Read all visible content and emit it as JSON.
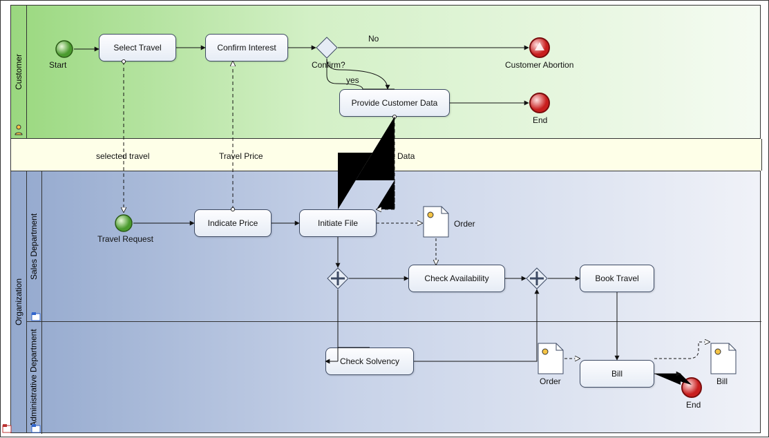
{
  "pools": {
    "customer": {
      "label": "Customer"
    },
    "organization": {
      "label": "Organization"
    }
  },
  "lanes": {
    "sales": {
      "label": "Sales Department"
    },
    "admin": {
      "label": "Administrative Department"
    }
  },
  "events": {
    "start": {
      "label": "Start"
    },
    "travel_request": {
      "label": "Travel Request"
    },
    "customer_abortion": {
      "label": "Customer Abortion"
    },
    "end_customer": {
      "label": "End"
    },
    "end_admin": {
      "label": "End"
    }
  },
  "tasks": {
    "select_travel": {
      "label": "Select Travel"
    },
    "confirm_interest": {
      "label": "Confirm Interest"
    },
    "provide_customer_data": {
      "label": "Provide Customer Data"
    },
    "indicate_price": {
      "label": "Indicate Price"
    },
    "initiate_file": {
      "label": "Initiate File"
    },
    "check_availability": {
      "label": "Check Availability"
    },
    "check_solvency": {
      "label": "Check Solvency"
    },
    "book_travel": {
      "label": "Book Travel"
    },
    "bill": {
      "label": "Bill"
    }
  },
  "gateways": {
    "confirm": {
      "label": "Confirm?",
      "yes": "yes",
      "no": "No"
    },
    "parallel_split": {},
    "parallel_join": {}
  },
  "data_objects": {
    "order_top": {
      "label": "Order"
    },
    "order_bottom": {
      "label": "Order"
    },
    "bill_doc": {
      "label": "Bill"
    }
  },
  "messages": {
    "selected_travel": "selected travel",
    "travel_price": "Travel Price",
    "client_data": "Client Data"
  },
  "chart_data": {
    "type": "bpmn",
    "pools": [
      {
        "id": "customer",
        "name": "Customer",
        "lanes": [
          "customer"
        ]
      },
      {
        "id": "organization",
        "name": "Organization",
        "lanes": [
          "sales",
          "admin"
        ]
      }
    ],
    "lanes": [
      {
        "id": "customer",
        "name": "Customer",
        "pool": "customer"
      },
      {
        "id": "sales",
        "name": "Sales Department",
        "pool": "organization"
      },
      {
        "id": "admin",
        "name": "Administrative Department",
        "pool": "organization"
      }
    ],
    "elements": [
      {
        "id": "start",
        "type": "startEvent",
        "name": "Start",
        "lane": "customer"
      },
      {
        "id": "select_travel",
        "type": "task",
        "name": "Select Travel",
        "lane": "customer"
      },
      {
        "id": "confirm_interest",
        "type": "task",
        "name": "Confirm Interest",
        "lane": "customer"
      },
      {
        "id": "gw_confirm",
        "type": "exclusiveGateway",
        "name": "Confirm?",
        "lane": "customer"
      },
      {
        "id": "customer_abortion",
        "type": "endEvent",
        "subtype": "terminate",
        "name": "Customer Abortion",
        "lane": "customer"
      },
      {
        "id": "provide_customer_data",
        "type": "task",
        "name": "Provide Customer Data",
        "lane": "customer"
      },
      {
        "id": "end_customer",
        "type": "endEvent",
        "name": "End",
        "lane": "customer"
      },
      {
        "id": "travel_request",
        "type": "startEvent",
        "subtype": "message",
        "name": "Travel Request",
        "lane": "sales"
      },
      {
        "id": "indicate_price",
        "type": "task",
        "name": "Indicate Price",
        "lane": "sales"
      },
      {
        "id": "initiate_file",
        "type": "task",
        "name": "Initiate File",
        "lane": "sales"
      },
      {
        "id": "gw_split",
        "type": "parallelGateway",
        "lane": "sales"
      },
      {
        "id": "check_availability",
        "type": "task",
        "name": "Check Availability",
        "lane": "sales"
      },
      {
        "id": "gw_join",
        "type": "parallelGateway",
        "lane": "sales"
      },
      {
        "id": "book_travel",
        "type": "task",
        "name": "Book Travel",
        "lane": "sales"
      },
      {
        "id": "check_solvency",
        "type": "task",
        "name": "Check Solvency",
        "lane": "admin"
      },
      {
        "id": "bill",
        "type": "task",
        "name": "Bill",
        "lane": "admin"
      },
      {
        "id": "end_admin",
        "type": "endEvent",
        "name": "End",
        "lane": "admin"
      },
      {
        "id": "do_order_top",
        "type": "dataObject",
        "name": "Order",
        "lane": "sales"
      },
      {
        "id": "do_order_bottom",
        "type": "dataObject",
        "name": "Order",
        "lane": "admin"
      },
      {
        "id": "do_bill",
        "type": "dataObject",
        "name": "Bill",
        "lane": "admin"
      }
    ],
    "sequenceFlows": [
      {
        "from": "start",
        "to": "select_travel"
      },
      {
        "from": "select_travel",
        "to": "confirm_interest"
      },
      {
        "from": "confirm_interest",
        "to": "gw_confirm"
      },
      {
        "from": "gw_confirm",
        "to": "customer_abortion",
        "condition": "No"
      },
      {
        "from": "gw_confirm",
        "to": "provide_customer_data",
        "condition": "yes"
      },
      {
        "from": "provide_customer_data",
        "to": "end_customer"
      },
      {
        "from": "travel_request",
        "to": "indicate_price"
      },
      {
        "from": "indicate_price",
        "to": "initiate_file"
      },
      {
        "from": "initiate_file",
        "to": "gw_split"
      },
      {
        "from": "gw_split",
        "to": "check_availability"
      },
      {
        "from": "gw_split",
        "to": "check_solvency"
      },
      {
        "from": "check_availability",
        "to": "gw_join"
      },
      {
        "from": "check_solvency",
        "to": "gw_join"
      },
      {
        "from": "gw_join",
        "to": "book_travel"
      },
      {
        "from": "book_travel",
        "to": "bill"
      },
      {
        "from": "bill",
        "to": "end_admin"
      }
    ],
    "messageFlows": [
      {
        "from": "select_travel",
        "to": "travel_request",
        "name": "selected travel"
      },
      {
        "from": "indicate_price",
        "to": "confirm_interest",
        "name": "Travel Price"
      },
      {
        "from": "provide_customer_data",
        "to": "initiate_file",
        "name": "Client Data"
      }
    ],
    "dataAssociations": [
      {
        "from": "initiate_file",
        "to": "do_order_top"
      },
      {
        "from": "do_order_top",
        "to": "check_availability"
      },
      {
        "from": "do_order_bottom",
        "to": "bill"
      },
      {
        "from": "bill",
        "to": "do_bill"
      }
    ]
  }
}
